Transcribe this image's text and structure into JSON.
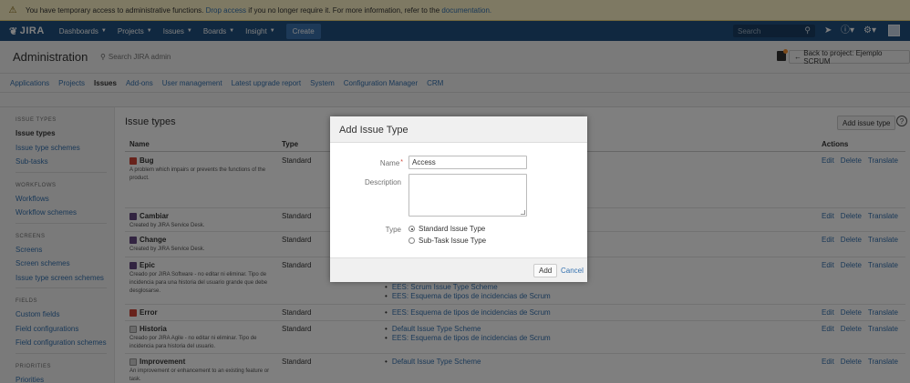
{
  "banner": {
    "text_before": "You have temporary access to administrative functions.",
    "drop_link": "Drop access",
    "text_middle": "if you no longer require it. For more information, refer to the",
    "doc_link": "documentation."
  },
  "topnav": {
    "logo": "JIRA",
    "items": [
      "Dashboards",
      "Projects",
      "Issues",
      "Boards",
      "Insight"
    ],
    "create": "Create",
    "search_placeholder": "Search"
  },
  "admin": {
    "title": "Administration",
    "search": "Search JIRA admin",
    "back": "Back to project: Ejemplo SCRUM",
    "tabs": [
      "Applications",
      "Projects",
      "Issues",
      "Add-ons",
      "User management",
      "Latest upgrade report",
      "System",
      "Configuration Manager",
      "CRM"
    ],
    "active_tab": "Issues"
  },
  "sidebar": {
    "sections": [
      {
        "heading": "ISSUE TYPES",
        "items": [
          "Issue types",
          "Issue type schemes",
          "Sub-tasks"
        ]
      },
      {
        "heading": "WORKFLOWS",
        "items": [
          "Workflows",
          "Workflow schemes"
        ]
      },
      {
        "heading": "SCREENS",
        "items": [
          "Screens",
          "Screen schemes",
          "Issue type screen schemes"
        ]
      },
      {
        "heading": "FIELDS",
        "items": [
          "Custom fields",
          "Field configurations",
          "Field configuration schemes"
        ]
      },
      {
        "heading": "PRIORITIES",
        "items": [
          "Priorities"
        ]
      }
    ]
  },
  "main": {
    "title": "Issue types",
    "add_button": "Add issue type",
    "columns": {
      "name": "Name",
      "type": "Type",
      "actions": "Actions"
    },
    "actions": [
      "Edit",
      "Delete",
      "Translate"
    ],
    "rows": [
      {
        "name": "Bug",
        "desc": "A problem which impairs or prevents the functions of the product.",
        "type": "Standard",
        "schemes": []
      },
      {
        "name": "Cambiar",
        "desc": "Created by JIRA Service Desk.",
        "type": "Standard",
        "schemes": []
      },
      {
        "name": "Change",
        "desc": "Created by JIRA Service Desk.",
        "type": "Standard",
        "schemes": []
      },
      {
        "name": "Epic",
        "desc": "Creado por JIRA Software - no editar ni eliminar. Tipo de incidencia para una historia del usuario grande que debe desglosarse.",
        "type": "Standard",
        "schemes": [
          "EES: Scrum Issue Type Scheme",
          "EES: Esquema de tipos de incidencias de Scrum"
        ]
      },
      {
        "name": "Error",
        "desc": "",
        "type": "Standard",
        "schemes": [
          "EES: Esquema de tipos de incidencias de Scrum"
        ]
      },
      {
        "name": "Historia",
        "desc": "Creado por JIRA Agile - no editar ni eliminar. Tipo de incidencia para historia del usuario.",
        "type": "Standard",
        "schemes": [
          "Default Issue Type Scheme",
          "EES: Esquema de tipos de incidencias de Scrum"
        ]
      },
      {
        "name": "Improvement",
        "desc": "An improvement or enhancement to an existing feature or task.",
        "type": "Standard",
        "schemes": [
          "Default Issue Type Scheme"
        ]
      }
    ]
  },
  "dialog": {
    "title": "Add Issue Type",
    "name_label": "Name",
    "name_value": "Access",
    "description_label": "Description",
    "type_label": "Type",
    "type_options": [
      "Standard Issue Type",
      "Sub-Task Issue Type"
    ],
    "selected_type": "Standard Issue Type",
    "add": "Add",
    "cancel": "Cancel"
  }
}
